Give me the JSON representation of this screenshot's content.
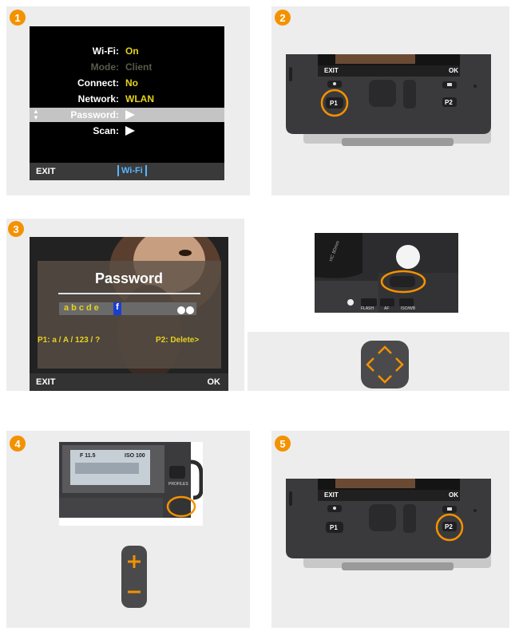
{
  "steps": [
    "1",
    "2",
    "3",
    "4",
    "5"
  ],
  "wifi_menu": {
    "rows": [
      {
        "label": "Wi-Fi:",
        "value": "On"
      },
      {
        "label": "Mode:",
        "value": "Client"
      },
      {
        "label": "Connect:",
        "value": "No"
      },
      {
        "label": "Network:",
        "value": "WLAN"
      },
      {
        "label": "Password:",
        "value": ""
      },
      {
        "label": "Scan:",
        "value": ""
      }
    ],
    "exit_label": "EXIT",
    "tab_label": "Wi-Fi"
  },
  "step2": {
    "exit_label": "EXIT",
    "ok_label": "OK",
    "p1_label": "P1",
    "p2_label": "P2"
  },
  "password_screen": {
    "title": "Password",
    "chars": "abcde",
    "cursor_char": "f",
    "hint_left": "P1: a / A / 123 / ?",
    "hint_right": "P2: Delete>",
    "exit_label": "EXIT",
    "ok_label": "OK"
  },
  "camera_top": {
    "lens_text": "HC 80mm",
    "labels": [
      "FLASH",
      "AF",
      "ISO/WB"
    ]
  },
  "step4": {
    "lcd_text": "ISO 100",
    "lcd_text2": "F 11.5",
    "profiles_label": "PROFILES"
  },
  "step5": {
    "exit_label": "EXIT",
    "ok_label": "OK",
    "p1_label": "P1",
    "p2_label": "P2"
  },
  "colors": {
    "accent": "#f39200",
    "panel": "#ededed",
    "highlight": "#e6d21e"
  }
}
